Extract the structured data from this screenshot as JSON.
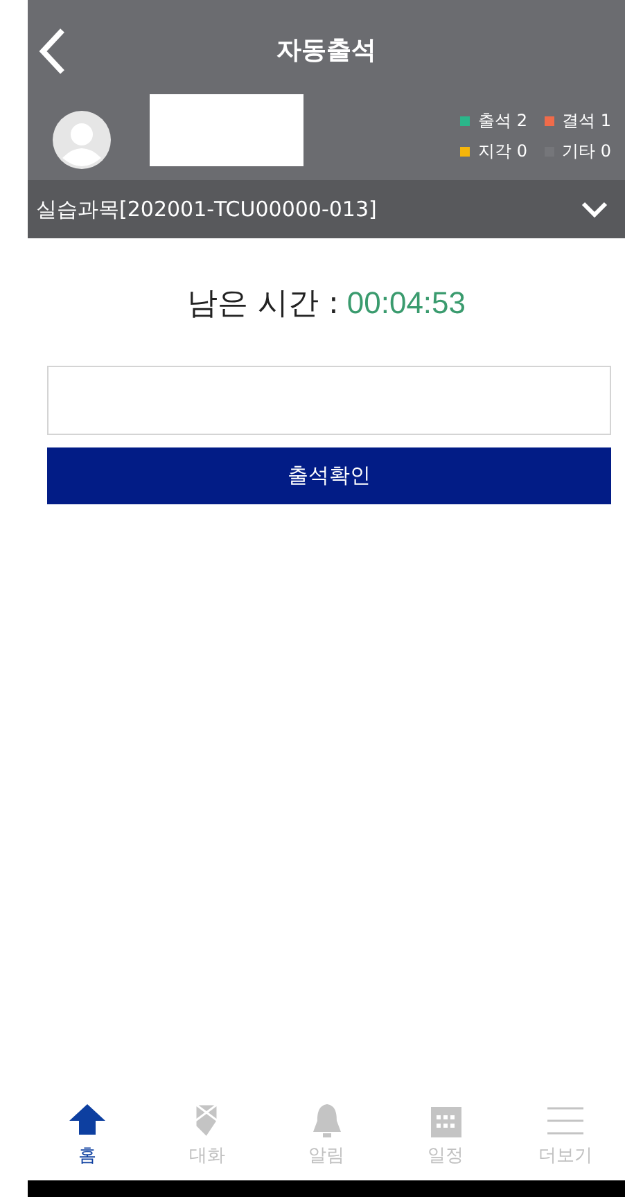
{
  "header": {
    "title": "자동출석"
  },
  "stats": [
    {
      "label": "출석",
      "count": "2",
      "color": "#2bb68a"
    },
    {
      "label": "결석",
      "count": "1",
      "color": "#f06b4a"
    },
    {
      "label": "지각",
      "count": "0",
      "color": "#f5b50a"
    },
    {
      "label": "기타",
      "count": "0",
      "color": "#75767a"
    }
  ],
  "course": {
    "label": "실습과목[202001-TCU00000-013]"
  },
  "timer": {
    "label": "남은 시간 :",
    "value": "00:04:53"
  },
  "confirm_button": "출석확인",
  "nav": [
    {
      "kind": "home",
      "label": "홈",
      "selected": true
    },
    {
      "kind": "chat",
      "label": "대화",
      "selected": false
    },
    {
      "kind": "bell",
      "label": "알림",
      "selected": false
    },
    {
      "kind": "calendar",
      "label": "일정",
      "selected": false
    },
    {
      "kind": "menu",
      "label": "더보기",
      "selected": false
    }
  ]
}
